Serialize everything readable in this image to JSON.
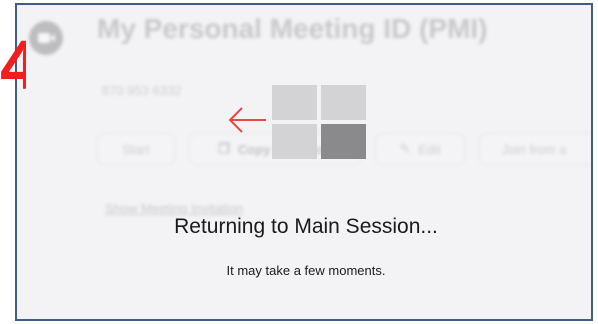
{
  "step": {
    "number": "4"
  },
  "background": {
    "title": "My Personal Meeting ID (PMI)",
    "meeting_id": "870 953 6332",
    "buttons": {
      "start": "Start",
      "copy": "Copy Invitation",
      "edit": "Edit",
      "join": "Join from a"
    },
    "show_invitation": "Show Meeting Invitation"
  },
  "overlay": {
    "title": "Returning to Main Session...",
    "subtitle": "It may take a few moments.",
    "arrow_color": "#e8483f"
  },
  "colors": {
    "step_red": "#f01e1e",
    "frame_border": "#3f5f82"
  }
}
